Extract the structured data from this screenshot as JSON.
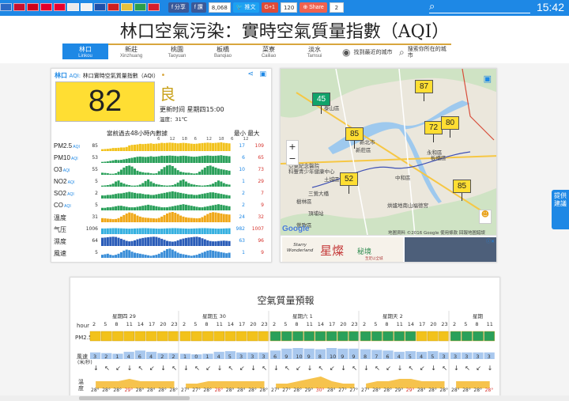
{
  "topbar": {
    "flags": [
      "#2d6ac4",
      "#c8102e",
      "#d0021b",
      "#e4002b",
      "#e8002d",
      "#eaeaea",
      "#f2f2f2",
      "#1f4fa8",
      "#cd1f1f",
      "#e7c13b",
      "#2b9e4a",
      "#d51e2b"
    ],
    "share_fb": "分享",
    "share_fb2": "讚",
    "share_fb2_count": "8,068",
    "tweet": "推文",
    "gplus": "G+1",
    "gplus_count": "120",
    "share_btn": "Share",
    "share_count": "2",
    "time": "15:42"
  },
  "title": "林口空氣污染：實時空氣質量指數（AQI）",
  "nav": [
    {
      "zh": "林口",
      "en": "Linkou",
      "active": true
    },
    {
      "zh": "新莊",
      "en": "Xinzhuang"
    },
    {
      "zh": "桃園",
      "en": "Taoyuan"
    },
    {
      "zh": "板橋",
      "en": "Banqiao"
    },
    {
      "zh": "菜寮",
      "en": "Cailiao"
    },
    {
      "zh": "淡水",
      "en": "Tamsui"
    }
  ],
  "nav_tools": {
    "nearest": "找到最近的城市",
    "search": "搜索你所在的城市"
  },
  "aqi": {
    "city": "林口",
    "aqi_label": "AQI:",
    "description": "林口實時空氣質量指數（AQI）",
    "value": "82",
    "level": "良",
    "level_color": "#ffde33",
    "updated": "更新时间 星期四15:00",
    "temperature": "溫度：31℃",
    "history_label": "當前過去48小時內數據",
    "minmax_label": "最小 最大",
    "hour_ticks": [
      "6",
      "12",
      "18",
      "6",
      "12",
      "18",
      "6",
      "12"
    ],
    "rows": [
      {
        "name": "PM2.5",
        "sub": "AQI",
        "current": "85",
        "min": "17",
        "max": "109",
        "color": "#f2c21b",
        "series": [
          0.18,
          0.2,
          0.22,
          0.25,
          0.3,
          0.3,
          0.32,
          0.35,
          0.35,
          0.4,
          0.55,
          0.6,
          0.62,
          0.65,
          0.7,
          0.68,
          0.7,
          0.72,
          0.75,
          0.7,
          0.72,
          0.75,
          0.8,
          0.78,
          0.8,
          0.82,
          0.8,
          0.78,
          0.75,
          0.78,
          0.8,
          0.78,
          0.75,
          0.72,
          0.7,
          0.72,
          0.75,
          0.78,
          0.8,
          0.82,
          0.8,
          0.78,
          0.8,
          0.82,
          0.85,
          0.8,
          0.78,
          0.75
        ]
      },
      {
        "name": "PM10",
        "sub": "AQI",
        "current": "53",
        "min": "6",
        "max": "65",
        "color": "#2aa05a",
        "series": [
          0.1,
          0.12,
          0.15,
          0.2,
          0.25,
          0.3,
          0.28,
          0.3,
          0.35,
          0.4,
          0.45,
          0.5,
          0.55,
          0.6,
          0.62,
          0.6,
          0.58,
          0.6,
          0.65,
          0.6,
          0.62,
          0.65,
          0.7,
          0.68,
          0.7,
          0.72,
          0.7,
          0.68,
          0.65,
          0.68,
          0.7,
          0.68,
          0.65,
          0.62,
          0.6,
          0.62,
          0.65,
          0.68,
          0.7,
          0.72,
          0.7,
          0.68,
          0.7,
          0.72,
          0.75,
          0.7,
          0.68,
          0.65
        ]
      },
      {
        "name": "O3",
        "sub": "AQI",
        "current": "55",
        "min": "10",
        "max": "73",
        "color": "#2aa05a",
        "series": [
          0.2,
          0.18,
          0.15,
          0.1,
          0.1,
          0.15,
          0.3,
          0.5,
          0.7,
          0.85,
          0.9,
          0.8,
          0.6,
          0.4,
          0.3,
          0.25,
          0.2,
          0.2,
          0.15,
          0.12,
          0.15,
          0.35,
          0.55,
          0.75,
          0.9,
          0.95,
          0.85,
          0.65,
          0.45,
          0.3,
          0.25,
          0.2,
          0.2,
          0.15,
          0.12,
          0.15,
          0.3,
          0.5,
          0.7,
          0.85,
          0.9,
          0.8,
          0.7,
          0.6,
          0.55,
          0.5,
          0.45,
          0.4
        ]
      },
      {
        "name": "NO2",
        "sub": "AQI",
        "current": "5",
        "min": "1",
        "max": "29",
        "color": "#2aa05a",
        "series": [
          0.1,
          0.12,
          0.15,
          0.2,
          0.3,
          0.5,
          0.6,
          0.4,
          0.3,
          0.2,
          0.15,
          0.1,
          0.1,
          0.12,
          0.2,
          0.35,
          0.55,
          0.7,
          0.5,
          0.35,
          0.25,
          0.2,
          0.15,
          0.12,
          0.1,
          0.12,
          0.15,
          0.25,
          0.4,
          0.6,
          0.7,
          0.5,
          0.35,
          0.25,
          0.2,
          0.15,
          0.12,
          0.1,
          0.12,
          0.15,
          0.2,
          0.3,
          0.45,
          0.6,
          0.5,
          0.35,
          0.25,
          0.2
        ]
      },
      {
        "name": "SO2",
        "sub": "AQI",
        "current": "2",
        "min": "2",
        "max": "7",
        "color": "#2aa05a",
        "series": [
          0.3,
          0.3,
          0.35,
          0.35,
          0.4,
          0.45,
          0.5,
          0.5,
          0.55,
          0.6,
          0.65,
          0.6,
          0.55,
          0.5,
          0.5,
          0.45,
          0.4,
          0.4,
          0.35,
          0.35,
          0.4,
          0.45,
          0.5,
          0.55,
          0.6,
          0.65,
          0.7,
          0.65,
          0.6,
          0.55,
          0.5,
          0.45,
          0.4,
          0.4,
          0.35,
          0.35,
          0.4,
          0.45,
          0.5,
          0.55,
          0.6,
          0.6,
          0.55,
          0.5,
          0.45,
          0.4,
          0.35,
          0.3
        ]
      },
      {
        "name": "CO",
        "sub": "AQI",
        "current": "5",
        "min": "2",
        "max": "9",
        "color": "#2aa05a",
        "series": [
          0.25,
          0.25,
          0.3,
          0.3,
          0.35,
          0.4,
          0.45,
          0.45,
          0.4,
          0.35,
          0.3,
          0.3,
          0.3,
          0.35,
          0.4,
          0.45,
          0.5,
          0.55,
          0.5,
          0.45,
          0.4,
          0.35,
          0.3,
          0.3,
          0.3,
          0.35,
          0.4,
          0.45,
          0.5,
          0.55,
          0.6,
          0.55,
          0.5,
          0.45,
          0.4,
          0.35,
          0.3,
          0.3,
          0.35,
          0.4,
          0.45,
          0.5,
          0.55,
          0.6,
          0.55,
          0.5,
          0.45,
          0.4
        ]
      },
      {
        "name": "溫度",
        "sub": "",
        "current": "31",
        "min": "24",
        "max": "32",
        "color": "#f0a818",
        "series": [
          0.4,
          0.38,
          0.35,
          0.33,
          0.3,
          0.32,
          0.4,
          0.55,
          0.7,
          0.85,
          0.95,
          0.9,
          0.8,
          0.65,
          0.55,
          0.48,
          0.44,
          0.42,
          0.4,
          0.38,
          0.36,
          0.42,
          0.55,
          0.7,
          0.85,
          0.95,
          1.0,
          0.92,
          0.8,
          0.65,
          0.55,
          0.48,
          0.44,
          0.42,
          0.4,
          0.38,
          0.4,
          0.5,
          0.65,
          0.8,
          0.92,
          0.98,
          0.95,
          0.9,
          0.85,
          0.8,
          0.78,
          0.75
        ]
      },
      {
        "name": "气压",
        "sub": "",
        "current": "1006",
        "min": "982",
        "max": "1007",
        "color": "#35b0e0",
        "series": [
          0.55,
          0.55,
          0.56,
          0.57,
          0.58,
          0.58,
          0.57,
          0.56,
          0.55,
          0.54,
          0.53,
          0.54,
          0.55,
          0.56,
          0.57,
          0.58,
          0.58,
          0.57,
          0.56,
          0.55,
          0.54,
          0.53,
          0.54,
          0.55,
          0.56,
          0.57,
          0.58,
          0.58,
          0.57,
          0.56,
          0.55,
          0.54,
          0.53,
          0.54,
          0.55,
          0.56,
          0.57,
          0.58,
          0.58,
          0.57,
          0.56,
          0.55,
          0.54,
          0.53,
          0.54,
          0.55,
          0.56,
          0.57
        ]
      },
      {
        "name": "濕度",
        "sub": "",
        "current": "64",
        "min": "63",
        "max": "96",
        "color": "#2a5cb8",
        "series": [
          0.8,
          0.82,
          0.85,
          0.88,
          0.9,
          0.88,
          0.8,
          0.7,
          0.6,
          0.5,
          0.45,
          0.48,
          0.55,
          0.65,
          0.72,
          0.78,
          0.82,
          0.85,
          0.88,
          0.9,
          0.88,
          0.8,
          0.7,
          0.6,
          0.5,
          0.45,
          0.42,
          0.45,
          0.55,
          0.65,
          0.72,
          0.78,
          0.82,
          0.85,
          0.88,
          0.9,
          0.85,
          0.75,
          0.65,
          0.55,
          0.48,
          0.45,
          0.45,
          0.48,
          0.5,
          0.52,
          0.5,
          0.48
        ]
      },
      {
        "name": "風速",
        "sub": "",
        "current": "5",
        "min": "1",
        "max": "9",
        "color": "#3a8ed8",
        "series": [
          0.3,
          0.35,
          0.4,
          0.3,
          0.25,
          0.3,
          0.4,
          0.55,
          0.7,
          0.8,
          0.75,
          0.6,
          0.5,
          0.45,
          0.4,
          0.35,
          0.3,
          0.25,
          0.2,
          0.25,
          0.3,
          0.4,
          0.55,
          0.7,
          0.85,
          0.9,
          0.8,
          0.65,
          0.5,
          0.4,
          0.35,
          0.3,
          0.25,
          0.2,
          0.25,
          0.3,
          0.4,
          0.5,
          0.6,
          0.7,
          0.75,
          0.7,
          0.65,
          0.6,
          0.55,
          0.5,
          0.45,
          0.5
        ]
      }
    ]
  },
  "map": {
    "google": "Google",
    "attribution": "地圖資料 ©2016 Google  使用條款  回報地圖錯誤",
    "zoom_in": "+",
    "zoom_out": "−",
    "place_labels": [
      "泰山區",
      "新莊區",
      "新北市",
      "中和區",
      "土城區",
      "永和區",
      "板橋區",
      "樹林區",
      "亞東紀念醫院",
      "科豐青少年健康中心",
      "三鶯大橋",
      "鶯歌區",
      "烘爐地南山福德宮",
      "頂埔站"
    ],
    "stations": [
      {
        "value": "45",
        "color": "green"
      },
      {
        "value": "87",
        "color": "yellow"
      },
      {
        "value": "85",
        "color": "yellow"
      },
      {
        "value": "72",
        "color": "yellow"
      },
      {
        "value": "80",
        "color": "yellow"
      },
      {
        "value": "52",
        "color": "yellow"
      },
      {
        "value": "85",
        "color": "yellow"
      }
    ]
  },
  "ad": {
    "logo_line1": "Starry",
    "logo_line2": "Wonderland",
    "title": "星燦",
    "sub": "秘境",
    "small": "至足以全城",
    "close": "ⓘ✕"
  },
  "sidetab": "提供建議",
  "forecast": {
    "title": "空氣質量預報",
    "hour_label": "hour",
    "pm_label": "PM2.5",
    "wind_label": "風速",
    "wind_unit": "(米/秒)",
    "temp_label": "溫度",
    "days": [
      {
        "name": "星期四 29",
        "hours": [
          "2",
          "5",
          "8",
          "11",
          "14",
          "17",
          "20",
          "23"
        ],
        "pm": [
          "y",
          "y",
          "y",
          "y",
          "y",
          "y",
          "y",
          "y"
        ],
        "wind": [
          "3",
          "2",
          "1",
          "4",
          "6",
          "4",
          "2",
          "2"
        ],
        "temps": [
          "28°",
          "28°",
          "28°",
          "29°",
          "28°",
          "28°",
          "28°",
          "28°"
        ],
        "hot": [
          false,
          false,
          false,
          true,
          false,
          false,
          false,
          false
        ]
      },
      {
        "name": "星期五 30",
        "hours": [
          "2",
          "5",
          "8",
          "11",
          "14",
          "17",
          "20",
          "23"
        ],
        "pm": [
          "y",
          "y",
          "y",
          "y",
          "y",
          "y",
          "y",
          "y"
        ],
        "wind": [
          "1",
          "0",
          "1",
          "4",
          "5",
          "3",
          "3",
          "3"
        ],
        "temps": [
          "27°",
          "27°",
          "28°",
          "28°",
          "28°",
          "28°",
          "28°",
          "28°"
        ],
        "hot": [
          false,
          false,
          false,
          true,
          false,
          false,
          false,
          false
        ]
      },
      {
        "name": "星期六 1",
        "hours": [
          "2",
          "5",
          "8",
          "11",
          "14",
          "17",
          "20",
          "23"
        ],
        "pm": [
          "g",
          "g",
          "g",
          "g",
          "g",
          "g",
          "g",
          "g"
        ],
        "wind": [
          "6",
          "9",
          "10",
          "9",
          "8",
          "10",
          "9",
          "9"
        ],
        "temps": [
          "27°",
          "27°",
          "28°",
          "29°",
          "30°",
          "28°",
          "27°",
          "27°"
        ],
        "hot": [
          false,
          false,
          false,
          false,
          true,
          false,
          false,
          false
        ]
      },
      {
        "name": "星期天 2",
        "hours": [
          "2",
          "5",
          "8",
          "11",
          "14",
          "17",
          "20",
          "23"
        ],
        "pm": [
          "g",
          "g",
          "g",
          "g",
          "g",
          "y",
          "y",
          "y"
        ],
        "wind": [
          "8",
          "7",
          "6",
          "4",
          "5",
          "4",
          "5",
          "3"
        ],
        "temps": [
          "27°",
          "28°",
          "28°",
          "29°",
          "29°",
          "28°",
          "28°",
          "28°"
        ],
        "hot": [
          false,
          false,
          false,
          false,
          true,
          false,
          false,
          false
        ]
      },
      {
        "name": "星期",
        "hours": [
          "2",
          "5",
          "8",
          "11"
        ],
        "pm": [
          "g",
          "g",
          "g",
          "g"
        ],
        "wind": [
          "3",
          "3",
          "3",
          "3"
        ],
        "temps": [
          "28°",
          "28°",
          "28°",
          "28°"
        ],
        "hot": [
          false,
          false,
          false,
          true
        ]
      }
    ]
  }
}
